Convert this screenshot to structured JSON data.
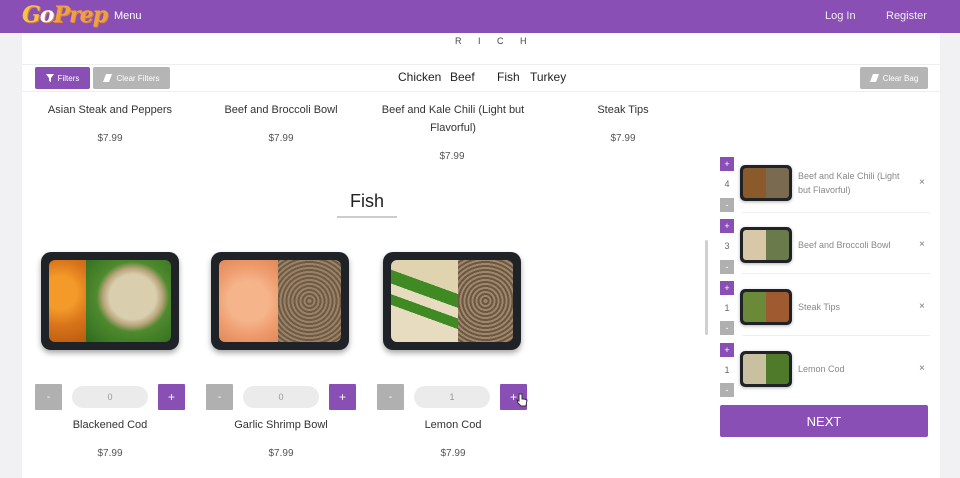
{
  "nav": {
    "logo": "GoPrep",
    "menu": "Menu",
    "login": "Log In",
    "register": "Register"
  },
  "decor_text": "R I C H",
  "filters": {
    "filters_label": "Filters",
    "clear_filters_label": "Clear Filters",
    "clear_bag_label": "Clear Bag",
    "categories": [
      "Chicken",
      "Beef",
      "Fish",
      "Turkey"
    ]
  },
  "beef_products": [
    {
      "name": "Asian Steak and Peppers",
      "price": "$7.99"
    },
    {
      "name": "Beef and Broccoli Bowl",
      "price": "$7.99"
    },
    {
      "name": "Beef and Kale Chili (Light but Flavorful)",
      "price": "$7.99"
    },
    {
      "name": "Steak Tips",
      "price": "$7.99"
    }
  ],
  "fish_section": {
    "title": "Fish",
    "products": [
      {
        "name": "Blackened Cod",
        "price": "$7.99",
        "qty": "0",
        "minus": "-",
        "plus": "+"
      },
      {
        "name": "Garlic Shrimp Bowl",
        "price": "$7.99",
        "qty": "0",
        "minus": "-",
        "plus": "+"
      },
      {
        "name": "Lemon Cod",
        "price": "$7.99",
        "qty": "1",
        "minus": "-",
        "plus": "+"
      }
    ]
  },
  "cart": {
    "items": [
      {
        "qty": "4",
        "name": "Beef and Kale Chili (Light but Flavorful)"
      },
      {
        "qty": "3",
        "name": "Beef and Broccoli Bowl"
      },
      {
        "qty": "1",
        "name": "Steak Tips"
      },
      {
        "qty": "1",
        "name": "Lemon Cod"
      }
    ],
    "plus": "+",
    "minus": "-",
    "remove": "×",
    "next_label": "NEXT"
  },
  "colors": {
    "brand_purple": "#8a4fb5",
    "button_gray": "#b0b0b0"
  }
}
